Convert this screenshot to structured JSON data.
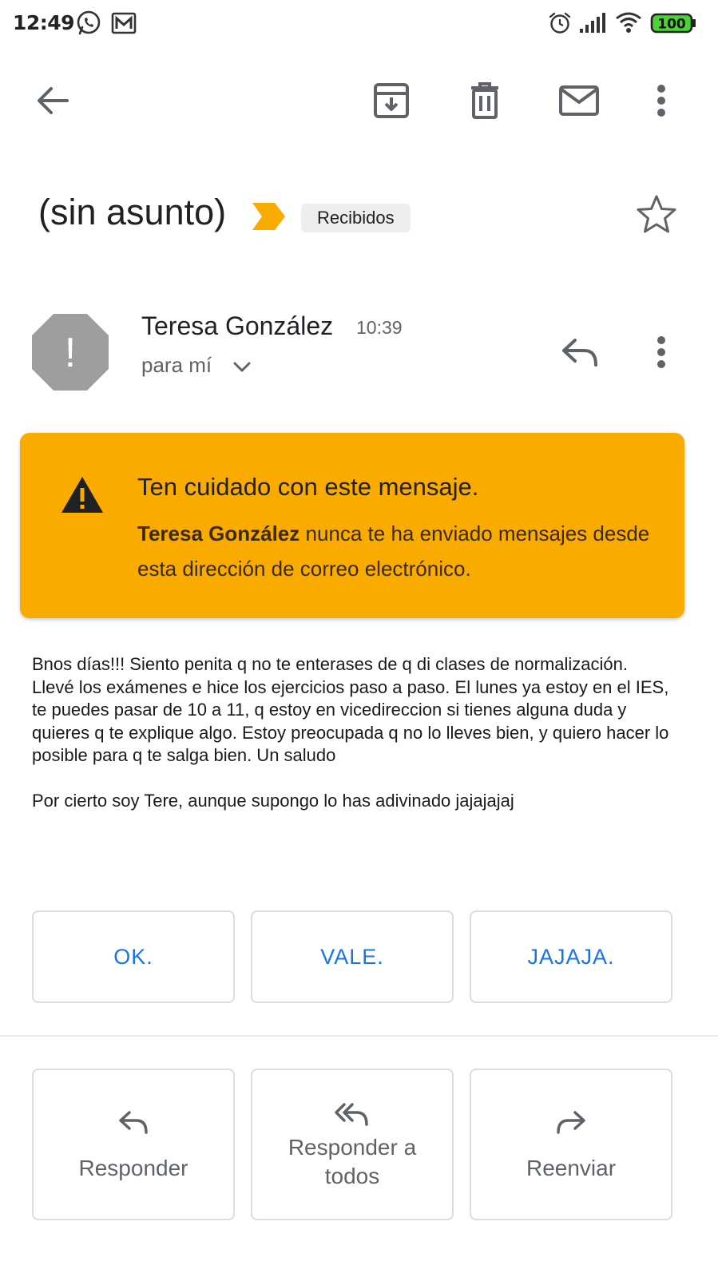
{
  "status_bar": {
    "time": "12:49",
    "battery": "100",
    "icons": [
      "whatsapp-icon",
      "gmail-notification-icon",
      "alarm-icon",
      "signal-icon",
      "wifi-icon",
      "battery-icon"
    ]
  },
  "toolbar": {
    "icons": [
      "back-arrow-icon",
      "archive-icon",
      "delete-icon",
      "mark-unread-icon",
      "more-vert-icon"
    ]
  },
  "subject": {
    "text": "(sin asunto)",
    "label": "Recibidos",
    "important_color": "#f9ab00"
  },
  "message": {
    "sender": "Teresa González",
    "time": "10:39",
    "recipient": "para mí",
    "avatar_color": "#9e9e9e",
    "avatar_symbol": "!"
  },
  "warning": {
    "title": "Ten cuidado con este mensaje.",
    "sender_bold": "Teresa González",
    "body_rest": " nunca te ha enviado mensajes desde esta dirección de correo electrónico.",
    "background": "#f9ab00"
  },
  "body": {
    "paragraph1": "Bnos días!!! Siento penita q no te enterases de q di clases de normalización. Llevé los exámenes e hice los ejercicios paso a paso. El lunes ya estoy en el IES, te puedes pasar de 10 a 11, q estoy en vicedireccion si tienes alguna duda y quieres q te explique algo. Estoy preocupada q no lo lleves bien, y quiero hacer lo posible para q te salga bien. Un saludo",
    "paragraph2": "Por cierto soy Tere, aunque supongo lo has adivinado jajajajaj"
  },
  "smart_replies": [
    "OK.",
    "VALE.",
    "JAJAJA."
  ],
  "actions": {
    "reply": "Responder",
    "reply_all_line1": "Responder a",
    "reply_all_line2": "todos",
    "forward": "Reenviar"
  }
}
